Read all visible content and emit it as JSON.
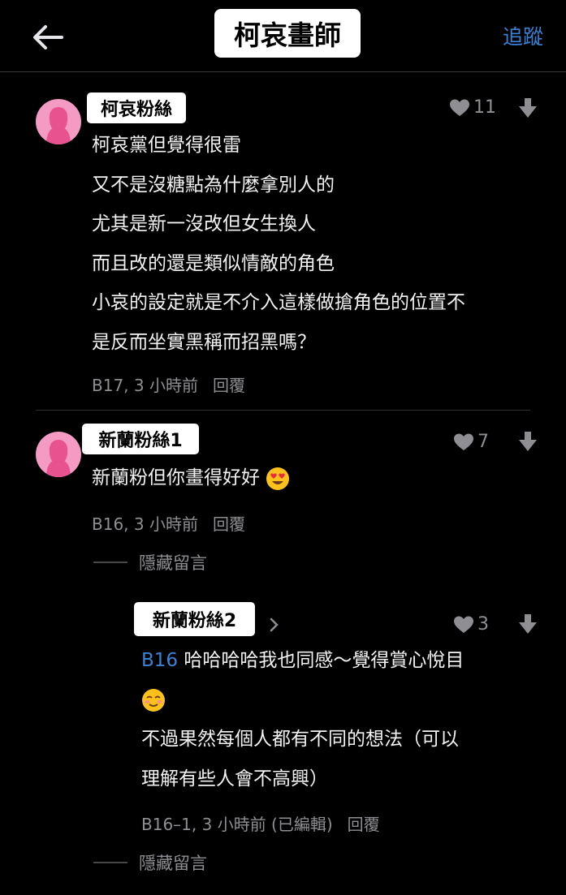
{
  "header": {
    "title": "柯哀畫師",
    "follow_label": "追蹤"
  },
  "comments": [
    {
      "author": "柯哀粉絲",
      "likes": "11",
      "lines": [
        "柯哀黨但覺得很雷",
        "又不是沒糖點為什麼拿別人的",
        "尤其是新一沒改但女生換人",
        "而且改的還是類似情敵的角色",
        "小哀的設定就是不介入這樣做搶角色的位置不",
        "是反而坐實黑稱而招黑嗎？"
      ],
      "meta": "B17, 3 小時前",
      "reply_label": "回覆"
    },
    {
      "author": "新蘭粉絲1",
      "likes": "7",
      "text": "新蘭粉但你畫得好好",
      "emoji": "heart-eyes-emoji",
      "meta": "B16, 3 小時前",
      "reply_label": "回覆",
      "hidden_label": "隱藏留言"
    }
  ],
  "reply": {
    "author": "新蘭粉絲2",
    "likes": "3",
    "ref": "B16",
    "line1": "哈哈哈哈我也同感～覺得賞心悅目",
    "emoji": "smiling-blush-emoji",
    "line3": "不過果然每個人都有不同的想法（可以",
    "line4": "理解有些人會不高興）",
    "meta": "B16–1, 3 小時前 (已編輯)",
    "reply_label": "回覆",
    "hidden_label": "隱藏留言"
  },
  "colors": {
    "background": "#000000",
    "accent_blue": "#3b82d6",
    "avatar_pink": "#f49bc3",
    "muted": "#8e8e93"
  }
}
